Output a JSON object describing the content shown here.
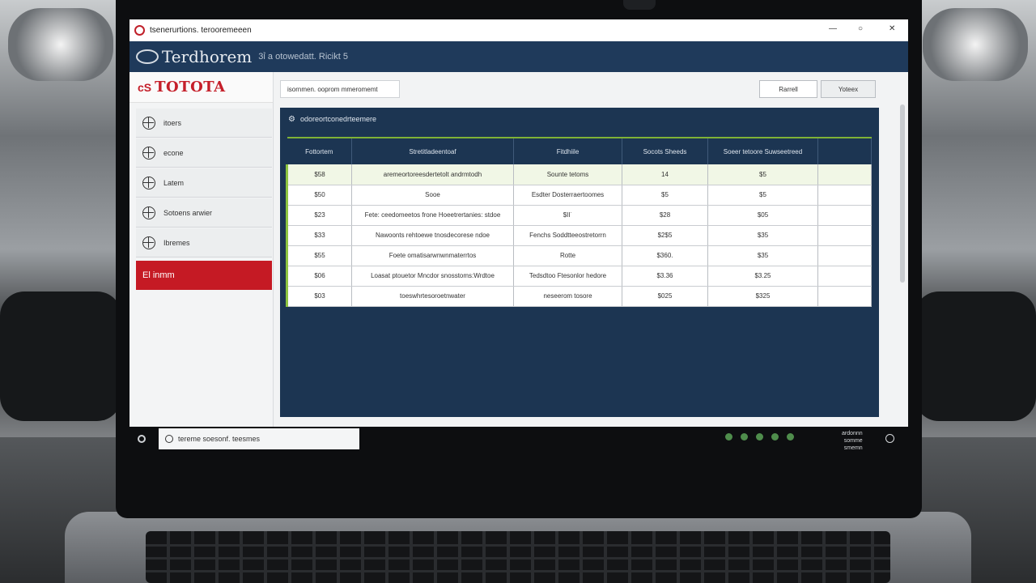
{
  "window": {
    "title": "tsenerurtions. terooremeeen",
    "controls": [
      "—",
      "○",
      "✕"
    ]
  },
  "header": {
    "brand": "Terdhorem",
    "subtitle": "3ỉ a otowedatt. Ricikt 5"
  },
  "sidebar": {
    "logo_mark": "cS",
    "logo_text": "TOTOTA",
    "items": [
      {
        "label": "itoers",
        "icon": "globe-icon"
      },
      {
        "label": "econe",
        "icon": "globe-icon"
      },
      {
        "label": "Latem",
        "icon": "globe-icon"
      },
      {
        "label": "Sotoens arwier",
        "icon": "globe-icon"
      },
      {
        "label": "Ibremes",
        "icon": "globe-icon"
      },
      {
        "label": "El inmm",
        "icon": "none",
        "active": true
      }
    ]
  },
  "toolbar": {
    "search_text": "isornmen. ooprom mmeromemt",
    "button1": "Rarrell",
    "button2": "Yoteex"
  },
  "panel": {
    "title": "odoreortconedrteemere",
    "icon": "gear-icon"
  },
  "table": {
    "columns": [
      "Fottortem",
      "Stretitladeentoaf",
      "Fitdhiile",
      "Socots Sheeds",
      "Soeer tetoore Suwseetreed",
      ""
    ],
    "rows": [
      [
        "$58",
        "aremeortoreesdertetolt andrmtodh",
        "Sounte tetoms",
        "14",
        "$5",
        ""
      ],
      [
        "$50",
        "Sooe",
        "Esdter Dosterraertoomes",
        "$5",
        "$5",
        ""
      ],
      [
        "$23",
        "Fete: ceedomeetos frone Hoeetrertanies: stdoe",
        "$II˙",
        "$28",
        "$05",
        ""
      ],
      [
        "$33",
        "Nawoonts rehtoewe tnosdecorese ndoe",
        "Fenchs Soddtteeostretorrn",
        "$2$5",
        "$35",
        ""
      ],
      [
        "$55",
        "Foete omatisarwnwnmaterrtos",
        "Rotte",
        "$360.",
        "$35",
        ""
      ],
      [
        "$06",
        "Loasat ptouetor Mncdor snosstoms:Wrdtoe",
        "Tedsdtoo Ftesonlor hedore",
        "$3.36",
        "$3.25",
        ""
      ],
      [
        "$03",
        "toeswhrtesoroetnwater",
        "neseerom tosore",
        "$025",
        "$325",
        ""
      ]
    ]
  },
  "taskbar": {
    "search_text": "tereme soesonf. teesmes",
    "clock": [
      "ardonnn",
      "somme",
      "smemn"
    ]
  }
}
